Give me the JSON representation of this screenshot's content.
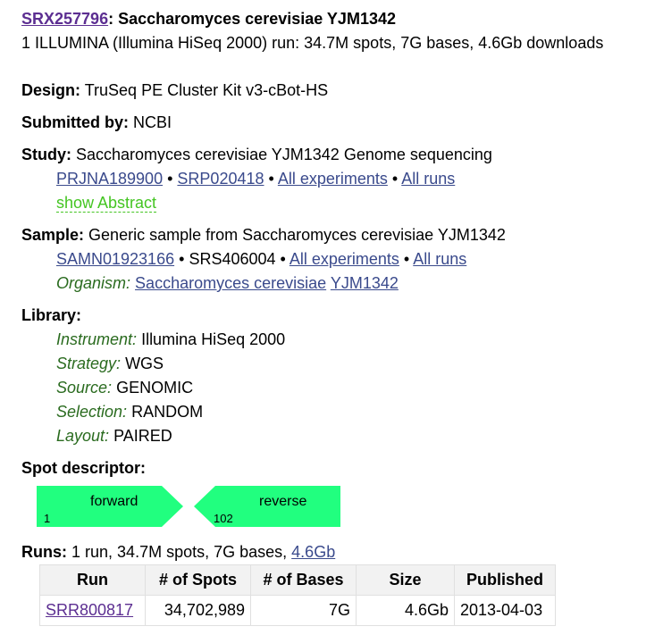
{
  "header": {
    "accession": "SRX257796",
    "title": "Saccharomyces cerevisiae YJM1342",
    "summary": "1 ILLUMINA (Illumina HiSeq 2000) run: 34.7M spots, 7G bases, 4.6Gb downloads"
  },
  "design": {
    "label": "Design:",
    "value": "TruSeq PE Cluster Kit v3-cBot-HS"
  },
  "submitted": {
    "label": "Submitted by:",
    "value": "NCBI"
  },
  "study": {
    "label": "Study:",
    "value": "Saccharomyces cerevisiae YJM1342 Genome sequencing",
    "bioproject": "PRJNA189900",
    "srp": "SRP020418",
    "all_experiments": "All experiments",
    "all_runs": "All runs",
    "show_abstract": "show Abstract"
  },
  "sample": {
    "label": "Sample:",
    "value": "Generic sample from Saccharomyces cerevisiae YJM1342",
    "biosample": "SAMN01923166",
    "srs": "SRS406004",
    "all_experiments": "All experiments",
    "all_runs": "All runs",
    "organism_label": "Organism:",
    "organism_link": "Saccharomyces cerevisiae",
    "organism_strain": "YJM1342"
  },
  "library": {
    "label": "Library:",
    "instrument_label": "Instrument:",
    "instrument": "Illumina HiSeq 2000",
    "strategy_label": "Strategy:",
    "strategy": "WGS",
    "source_label": "Source:",
    "source": "GENOMIC",
    "selection_label": "Selection:",
    "selection": "RANDOM",
    "layout_label": "Layout:",
    "layout": "PAIRED"
  },
  "spot": {
    "label": "Spot descriptor:",
    "forward_label": "forward",
    "forward_start": "1",
    "reverse_label": "reverse",
    "reverse_start": "102",
    "color": "#21ff7f"
  },
  "runs": {
    "label": "Runs:",
    "summary": "1 run, 34.7M spots, 7G bases,",
    "size_link": "4.6Gb",
    "columns": [
      "Run",
      "# of Spots",
      "# of Bases",
      "Size",
      "Published"
    ],
    "rows": [
      {
        "run": "SRR800817",
        "spots": "34,702,989",
        "bases": "7G",
        "size": "4.6Gb",
        "published": "2013-04-03"
      }
    ]
  },
  "sep": "•"
}
